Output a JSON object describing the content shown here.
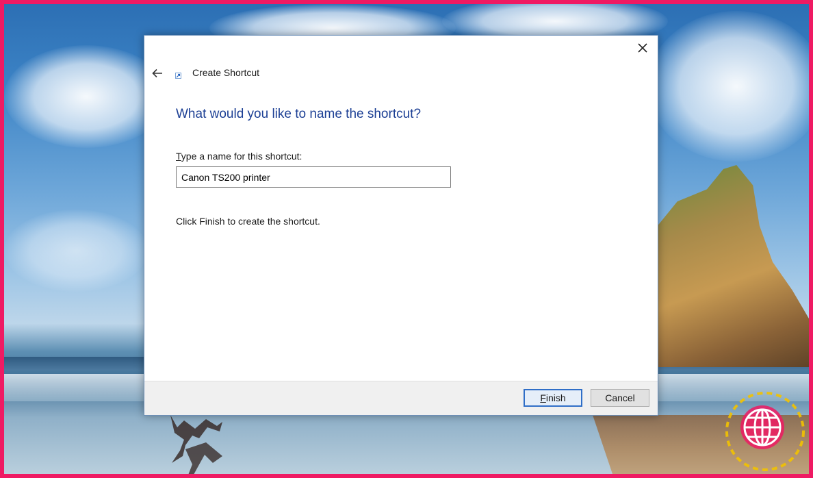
{
  "window": {
    "title": "Create Shortcut"
  },
  "wizard": {
    "heading": "What would you like to name the shortcut?",
    "name_label_accel": "T",
    "name_label_rest": "ype a name for this shortcut:",
    "name_value": "Canon TS200 printer",
    "instruction": "Click Finish to create the shortcut."
  },
  "buttons": {
    "finish_accel": "F",
    "finish_rest": "inish",
    "cancel_label": "Cancel"
  },
  "icons": {
    "close": "close-icon",
    "back": "back-arrow-icon",
    "shortcut": "shortcut-icon",
    "watermark": "globe-icon"
  },
  "colors": {
    "heading": "#1c3f94",
    "frame_border": "#ef1a63",
    "default_button_border": "#2f6ec7"
  }
}
